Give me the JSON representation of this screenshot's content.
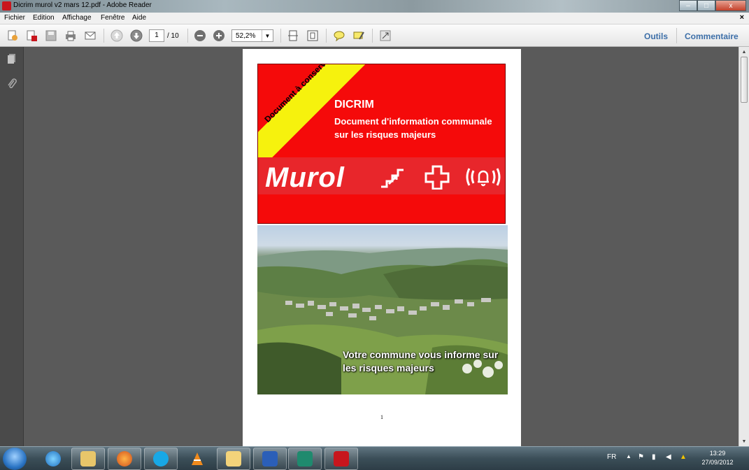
{
  "window": {
    "title": "Dicrim murol v2 mars 12.pdf - Adobe Reader",
    "buttons": {
      "minimize": "–",
      "maximize": "□",
      "close": "x"
    }
  },
  "menu": {
    "items": [
      "Fichier",
      "Edition",
      "Affichage",
      "Fenêtre",
      "Aide"
    ],
    "close_doc": "×"
  },
  "toolbar": {
    "page_current": "1",
    "page_total": "/ 10",
    "zoom": "52,2%",
    "zoom_dropdown": "▼",
    "tools_label": "Outils",
    "comment_label": "Commentaire",
    "icons": [
      "create-pdf-icon",
      "export-pdf-icon",
      "save-icon",
      "print-icon",
      "email-icon",
      "previous-page-icon",
      "next-page-icon",
      "zoom-out-icon",
      "zoom-in-icon",
      "fit-width-icon",
      "fit-page-icon",
      "comment-icon",
      "highlight-icon",
      "fullscreen-icon"
    ]
  },
  "navpanel": {
    "icons": [
      "pages-icon",
      "attachments-icon"
    ]
  },
  "document": {
    "yellow_band": "Document à conserver",
    "title": "DICRIM",
    "subtitle": "Document d'information communale sur les risques majeurs",
    "town": "Murol",
    "photo_caption": "Votre commune vous informe sur les risques majeurs",
    "page_number": "1",
    "colors": {
      "red": "#f50a0a",
      "yellow": "#f6f20d"
    }
  },
  "taskbar": {
    "apps": [
      "start-orb-icon",
      "ie-icon",
      "explorer-icon",
      "firefox-icon",
      "skype-icon",
      "vlc-icon",
      "folder-icon",
      "word-icon",
      "publisher-icon",
      "adobe-reader-icon"
    ],
    "language": "FR",
    "time": "13:29",
    "date": "27/09/2012"
  }
}
